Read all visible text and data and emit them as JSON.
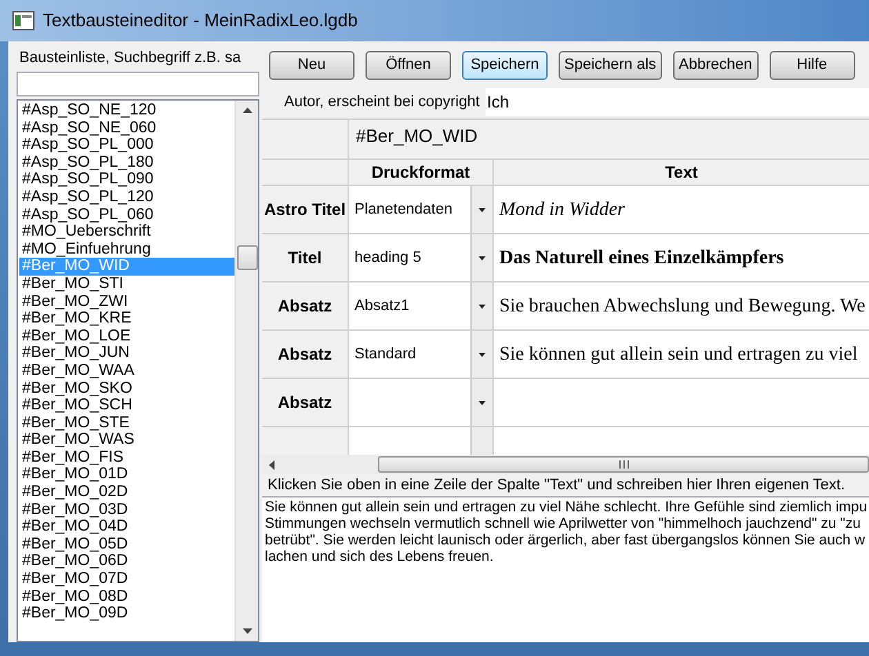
{
  "window": {
    "title": "Textbausteineditor - MeinRadixLeo.lgdb"
  },
  "sidebar": {
    "label": "Bausteinliste, Suchbegriff z.B. sa",
    "items": [
      {
        "label": "#Asp_SO_NE_120",
        "selected": false
      },
      {
        "label": "#Asp_SO_NE_060",
        "selected": false
      },
      {
        "label": "#Asp_SO_PL_000",
        "selected": false
      },
      {
        "label": "#Asp_SO_PL_180",
        "selected": false
      },
      {
        "label": "#Asp_SO_PL_090",
        "selected": false
      },
      {
        "label": "#Asp_SO_PL_120",
        "selected": false
      },
      {
        "label": "#Asp_SO_PL_060",
        "selected": false
      },
      {
        "label": "#MO_Ueberschrift",
        "selected": false
      },
      {
        "label": "#MO_Einfuehrung",
        "selected": false
      },
      {
        "label": "#Ber_MO_WID",
        "selected": true
      },
      {
        "label": "#Ber_MO_STI",
        "selected": false
      },
      {
        "label": "#Ber_MO_ZWI",
        "selected": false
      },
      {
        "label": "#Ber_MO_KRE",
        "selected": false
      },
      {
        "label": "#Ber_MO_LOE",
        "selected": false
      },
      {
        "label": "#Ber_MO_JUN",
        "selected": false
      },
      {
        "label": "#Ber_MO_WAA",
        "selected": false
      },
      {
        "label": "#Ber_MO_SKO",
        "selected": false
      },
      {
        "label": "#Ber_MO_SCH",
        "selected": false
      },
      {
        "label": "#Ber_MO_STE",
        "selected": false
      },
      {
        "label": "#Ber_MO_WAS",
        "selected": false
      },
      {
        "label": "#Ber_MO_FIS",
        "selected": false
      },
      {
        "label": "#Ber_MO_01D",
        "selected": false
      },
      {
        "label": "#Ber_MO_02D",
        "selected": false
      },
      {
        "label": "#Ber_MO_03D",
        "selected": false
      },
      {
        "label": "#Ber_MO_04D",
        "selected": false
      },
      {
        "label": "#Ber_MO_05D",
        "selected": false
      },
      {
        "label": "#Ber_MO_06D",
        "selected": false
      },
      {
        "label": "#Ber_MO_07D",
        "selected": false
      },
      {
        "label": "#Ber_MO_08D",
        "selected": false
      },
      {
        "label": "#Ber_MO_09D",
        "selected": false
      }
    ]
  },
  "toolbar": [
    {
      "label": "Neu",
      "focused": false
    },
    {
      "label": "Öffnen",
      "focused": false
    },
    {
      "label": "Speichern",
      "focused": true
    },
    {
      "label": "Speichern als",
      "focused": false
    },
    {
      "label": "Abbrechen",
      "focused": false
    },
    {
      "label": "Hilfe",
      "focused": false
    }
  ],
  "author": {
    "label": "Autor, erscheint bei copyright",
    "value": "Ich"
  },
  "grid": {
    "caption": "#Ber_MO_WID",
    "columns": [
      "Druckformat",
      "Text"
    ],
    "rows": [
      {
        "header": "Astro Titel",
        "format": "Planetendaten",
        "text": "Mond in Widder",
        "kind": "astro_title"
      },
      {
        "header": "Titel",
        "format": "heading 5",
        "text": "Das Naturell eines Einzelkämpfers",
        "kind": "title"
      },
      {
        "header": "Absatz",
        "format": "Absatz1",
        "text": "Sie brauchen Abwechslung und Bewegung. We",
        "kind": "paragraph"
      },
      {
        "header": "Absatz",
        "format": "Standard",
        "text": "Sie können gut allein sein und ertragen zu viel",
        "kind": "paragraph"
      },
      {
        "header": "Absatz",
        "kind": "paragraph"
      }
    ]
  },
  "hint": "Klicken Sie oben in eine Zeile der Spalte \"Text\" und schreiben hier Ihren eigenen Text.",
  "editor": {
    "lines": [
      "Sie können gut allein sein und ertragen zu viel Nähe schlecht. Ihre Gefühle sind ziemlich impu",
      "Stimmungen wechseln vermutlich schnell wie Aprilwetter von \"himmelhoch jauchzend\" zu \"zu",
      "betrübt\". Sie werden leicht launisch oder ärgerlich, aber fast übergangslos können Sie auch w",
      "lachen und sich des Lebens freuen."
    ]
  }
}
